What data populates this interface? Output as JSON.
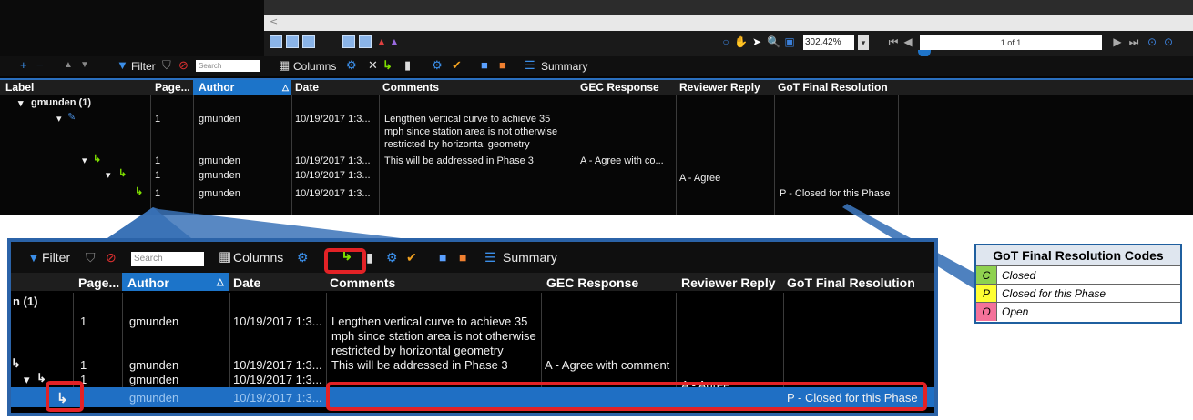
{
  "viewer": {
    "zoom_value": "302.42%",
    "page_indicator": "1 of 1",
    "scroll_left_symbol": "<"
  },
  "toolbar": {
    "filter_label": "Filter",
    "search_placeholder": "Search",
    "columns_label": "Columns",
    "summary_label": "Summary"
  },
  "columns": {
    "label": "Label",
    "page": "Page...",
    "author": "Author",
    "date": "Date",
    "comments": "Comments",
    "gec_response": "GEC Response",
    "reviewer_reply": "Reviewer Reply",
    "got_final_resolution": "GoT Final Resolution"
  },
  "group": {
    "top_label": "gmunden (1)",
    "zoom_label": "n (1)"
  },
  "rows": [
    {
      "page": "1",
      "author": "gmunden",
      "date": "10/19/2017 1:3...",
      "comment_lines": [
        "Lengthen vertical curve to achieve 35",
        "mph since station area is not otherwise",
        "restricted by horizontal geometry"
      ],
      "gec_response": "",
      "gec_response_truncated": "",
      "reviewer_reply": "",
      "final_resolution": ""
    },
    {
      "page": "1",
      "author": "gmunden",
      "date": "10/19/2017 1:3...",
      "comment_lines": [
        "This will be addressed in Phase 3"
      ],
      "gec_response": "A - Agree with comment",
      "gec_response_truncated": "A - Agree with co...",
      "reviewer_reply": "",
      "final_resolution": ""
    },
    {
      "page": "1",
      "author": "gmunden",
      "date": "10/19/2017 1:3...",
      "comment_lines": [],
      "gec_response": "",
      "gec_response_truncated": "",
      "reviewer_reply": "A - Agree",
      "final_resolution": ""
    },
    {
      "page": "1",
      "author": "gmunden",
      "date": "10/19/2017 1:3...",
      "comment_lines": [],
      "gec_response": "",
      "gec_response_truncated": "",
      "reviewer_reply": "",
      "final_resolution": "P - Closed for this Phase"
    }
  ],
  "legend": {
    "title": "GoT Final Resolution Codes",
    "codes": [
      {
        "code": "C",
        "desc": "Closed",
        "color": "#8fd14f"
      },
      {
        "code": "P",
        "desc": "Closed for this Phase",
        "color": "#ffff33"
      },
      {
        "code": "O",
        "desc": "Open",
        "color": "#f4729a"
      }
    ]
  },
  "colors": {
    "accent": "#1f6fc4",
    "highlight": "#e32226",
    "reply_arrow": "#7fe000"
  }
}
